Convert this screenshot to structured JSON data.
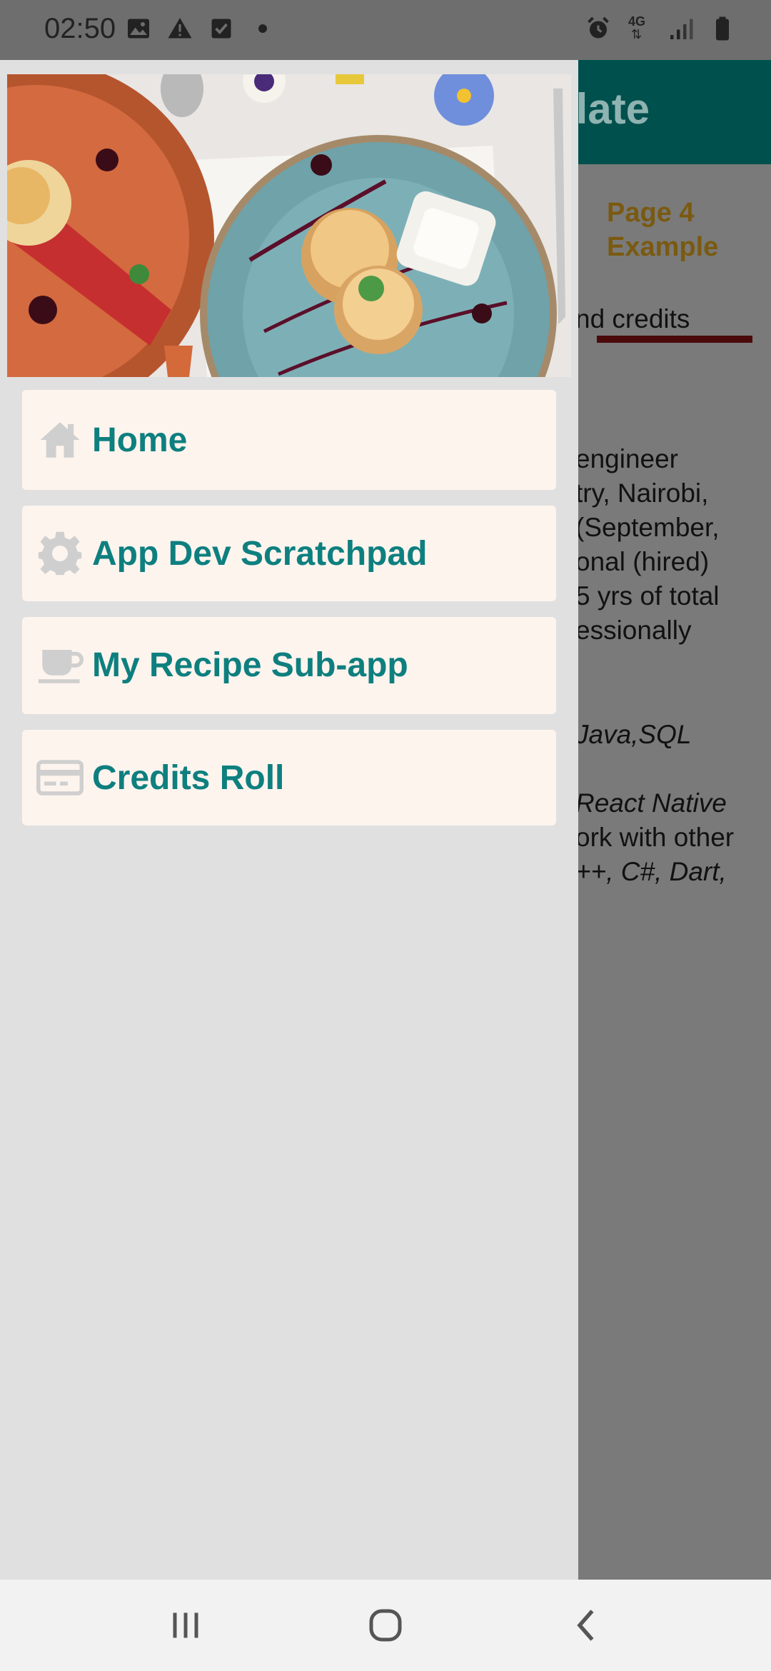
{
  "status_bar": {
    "time": "02:50",
    "left_icons": [
      "image-icon",
      "warning-icon",
      "checkbox-icon",
      "dot-icon"
    ],
    "right_icons": [
      "alarm-icon",
      "4g-icon",
      "signal-icon",
      "battery-icon"
    ],
    "network_label": "4G"
  },
  "background_app": {
    "header_title_fragment": "plate",
    "tab_label": "Page 4 Example",
    "text_lines": [
      "nd credits",
      "engineer",
      "try, Nairobi,",
      " (September,",
      "onal (hired)",
      "5 yrs of total",
      "essionally",
      "Java,SQL",
      "React Native",
      "ork with other",
      "++, C#, Dart,"
    ],
    "colors": {
      "header": "#00504e",
      "tab_text": "#7a5a10",
      "tab_underline": "#4a0a0a"
    }
  },
  "drawer": {
    "header_image": "food-plates-photo",
    "items": [
      {
        "label": "Home",
        "icon": "home-icon"
      },
      {
        "label": "App Dev Scratchpad",
        "icon": "gear-icon"
      },
      {
        "label": "My Recipe Sub-app",
        "icon": "coffee-cup-icon"
      },
      {
        "label": "Credits Roll",
        "icon": "credit-card-icon"
      }
    ],
    "colors": {
      "item_background": "#fdf4ee",
      "item_text": "#0e7f7f",
      "icon": "#cfcfcf",
      "drawer_background": "#e0e0e0"
    }
  },
  "nav_bar": {
    "buttons": [
      "recent-apps-icon",
      "home-circle-icon",
      "back-icon"
    ]
  }
}
